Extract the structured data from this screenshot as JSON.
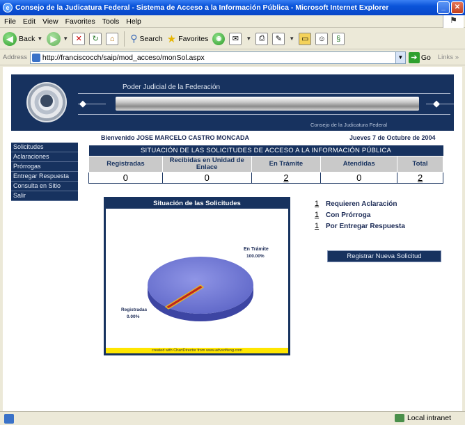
{
  "window": {
    "title": "Consejo de la Judicatura Federal - Sistema de Acceso a la Información Pública - Microsoft Internet Explorer",
    "min": "_",
    "max": "□"
  },
  "menu": [
    "File",
    "Edit",
    "View",
    "Favorites",
    "Tools",
    "Help"
  ],
  "toolbar": {
    "back": "Back",
    "search": "Search",
    "favorites": "Favorites"
  },
  "address": {
    "label": "Address",
    "url": "http://franciscocch/saip/mod_acceso/monSol.aspx",
    "go": "Go",
    "links": "Links"
  },
  "banner": {
    "line1": "Poder Judicial de la Federación",
    "line2": "Consejo de la Judicatura Federal"
  },
  "welcome": "Bienvenido JOSE MARCELO CASTRO MONCADA",
  "date": "Jueves 7 de Octubre de 2004",
  "sidebar": {
    "items": [
      {
        "label": "Solicitudes"
      },
      {
        "label": "Aclaraciones"
      },
      {
        "label": "Prórrogas"
      },
      {
        "label": "Entregar Respuesta"
      },
      {
        "label": "Consulta en Sitio"
      },
      {
        "label": "Salir"
      }
    ]
  },
  "stats": {
    "caption": "SITUACIÓN DE LAS SOLICITUDES DE ACCESO A LA INFORMACIÓN PÚBLICA",
    "headers": [
      "Registradas",
      "Recibidas en Unidad de Enlace",
      "En Trámite",
      "Atendidas",
      "Total"
    ],
    "values": [
      "0",
      "0",
      "2",
      "0",
      "2"
    ]
  },
  "chart": {
    "title": "Situación de las Solicitudes",
    "credit": "created with ChartDirector from www.advsofteng.com",
    "label_big": "En Trámite",
    "pct_big": "100.00%",
    "label_small": "Registradas",
    "pct_small": "0.00%"
  },
  "chart_data": {
    "type": "pie",
    "title": "Situación de las Solicitudes",
    "categories": [
      "En Trámite",
      "Registradas"
    ],
    "values": [
      100.0,
      0.0
    ]
  },
  "counts": [
    {
      "num": "1",
      "label": "Requieren Aclaración"
    },
    {
      "num": "1",
      "label": "Con Prórroga"
    },
    {
      "num": "1",
      "label": "Por Entregar Respuesta"
    }
  ],
  "register_button": "Registrar Nueva Solicitud",
  "status": {
    "zone": "Local intranet"
  },
  "colors": {
    "navy": "#17325f",
    "pie_main": "#6d75d4",
    "pie_small": "#c0261a",
    "credit_bar": "#ffe600"
  }
}
